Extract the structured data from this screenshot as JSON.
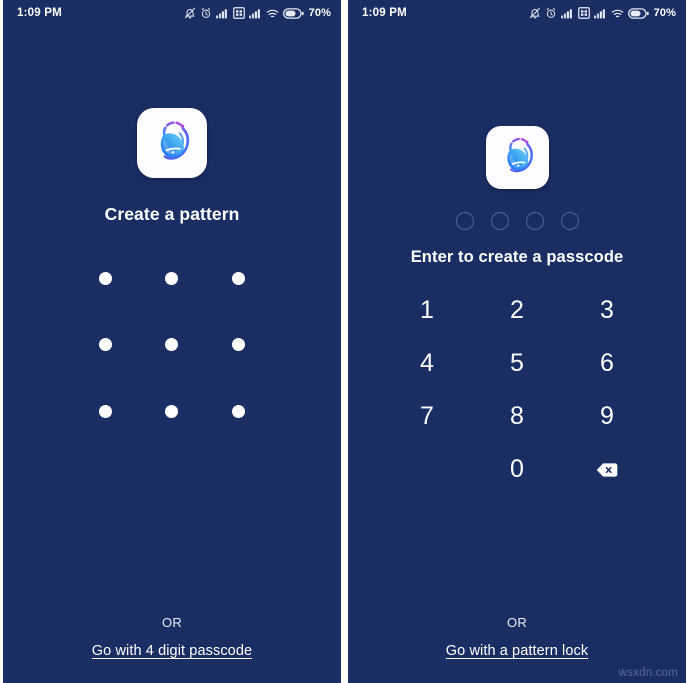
{
  "meta": {
    "watermark": "wsxdn.com",
    "background_color": "#1b2e63",
    "accent_color": "#ffffff",
    "dot_outline_color": "#53629b"
  },
  "status_bar": {
    "time": "1:09 PM",
    "battery_percent": "70%",
    "icons": [
      "bell-muted-icon",
      "alarm-clock-icon",
      "signal-bars-icon",
      "dual-sim-card-icon",
      "signal-bars-2-icon",
      "wifi-icon",
      "battery-icon"
    ]
  },
  "screens": [
    {
      "id": "pattern-screen",
      "logo_name": "app-logo-icon",
      "heading": "Create a pattern",
      "pattern": {
        "rows": 3,
        "cols": 3,
        "dot_count": 9,
        "dots": [
          {
            "row": 1,
            "col": 1
          },
          {
            "row": 1,
            "col": 2
          },
          {
            "row": 1,
            "col": 3
          },
          {
            "row": 2,
            "col": 1
          },
          {
            "row": 2,
            "col": 2
          },
          {
            "row": 2,
            "col": 3
          },
          {
            "row": 3,
            "col": 1
          },
          {
            "row": 3,
            "col": 2
          },
          {
            "row": 3,
            "col": 3
          }
        ]
      },
      "footer": {
        "or_label": "OR",
        "alt_link": "Go with 4 digit passcode"
      }
    },
    {
      "id": "passcode-screen",
      "logo_name": "app-logo-icon",
      "passcode": {
        "length": 4,
        "entered": 0,
        "dots": [
          "empty",
          "empty",
          "empty",
          "empty"
        ]
      },
      "heading": "Enter to create a passcode",
      "keypad": {
        "keys": [
          {
            "label": "1",
            "type": "digit"
          },
          {
            "label": "2",
            "type": "digit"
          },
          {
            "label": "3",
            "type": "digit"
          },
          {
            "label": "4",
            "type": "digit"
          },
          {
            "label": "5",
            "type": "digit"
          },
          {
            "label": "6",
            "type": "digit"
          },
          {
            "label": "7",
            "type": "digit"
          },
          {
            "label": "8",
            "type": "digit"
          },
          {
            "label": "9",
            "type": "digit"
          },
          {
            "label": "",
            "type": "blank"
          },
          {
            "label": "0",
            "type": "digit"
          },
          {
            "label": "",
            "type": "backspace",
            "icon": "backspace-icon"
          }
        ]
      },
      "footer": {
        "or_label": "OR",
        "alt_link": "Go with a pattern lock"
      }
    }
  ]
}
